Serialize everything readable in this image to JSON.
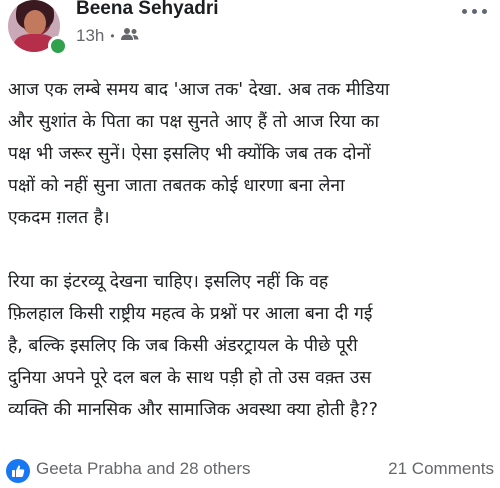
{
  "post": {
    "author_name": "Beena Sehyadri",
    "time": "13h",
    "separator": "•",
    "audience_icon": "friends-icon",
    "more_icon": "more-horizontal-icon",
    "paragraphs": [
      {
        "lines": [
          "आज एक लम्बे समय बाद 'आज तक' देखा. अब तक मीडिया",
          "और सुशांत के पिता का पक्ष सुनते आए हैं तो आज रिया का",
          "पक्ष भी जरूर सुनें। ऐसा इसलिए भी क्योंकि जब तक दोनों",
          "पक्षों को नहीं सुना जाता तबतक कोई धारणा बना लेना",
          "एकदम ग़लत है।"
        ]
      },
      {
        "lines": [
          "रिया का इंटरव्यू देखना चाहिए। इसलिए नहीं कि वह",
          "फ़िलहाल किसी राष्ट्रीय महत्व के प्रश्नों पर आला बना दी गई",
          "है, बल्कि इसलिए कि जब किसी अंडरट्रायल के पीछे पूरी",
          "दुनिया अपने पूरे दल बल के साथ पड़ी हो तो उस वक़्त उस",
          "व्यक्ति की मानसिक और सामाजिक अवस्था क्या होती है??"
        ]
      }
    ]
  },
  "footer": {
    "like_icon": "like-thumb-icon",
    "reactors": "Geeta Prabha and 28 others",
    "comments": "21 Comments"
  },
  "colors": {
    "like_blue": "#1877f2",
    "online_green": "#31a24c",
    "secondary_text": "#65676b",
    "primary_text": "#1c1e21"
  }
}
